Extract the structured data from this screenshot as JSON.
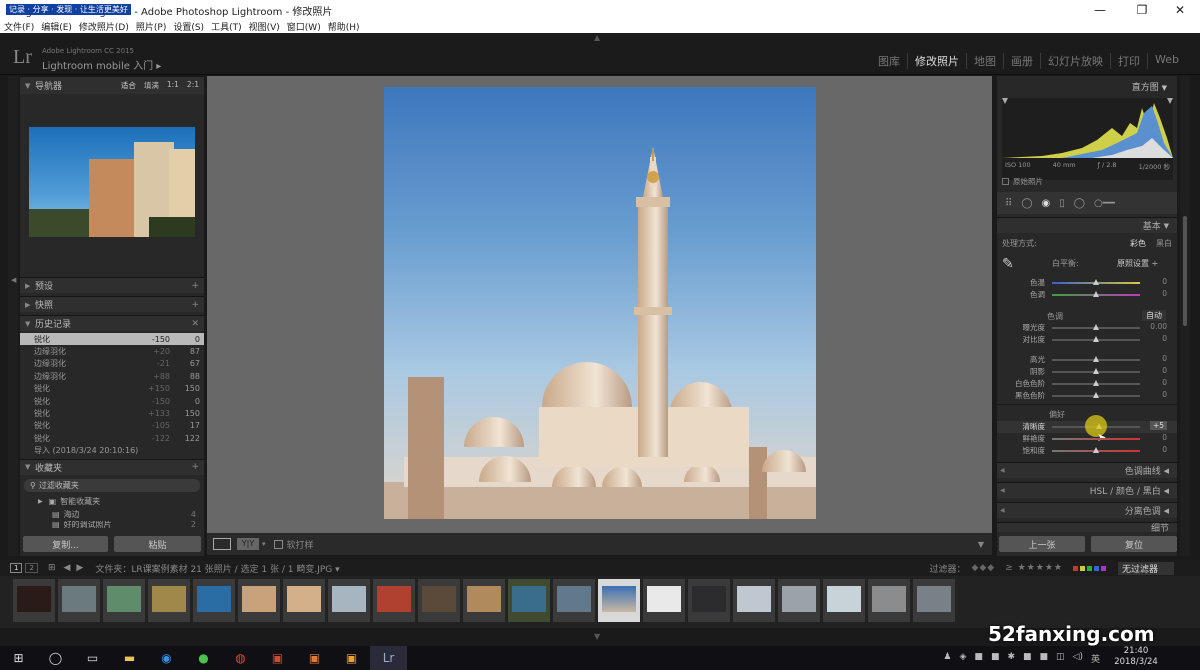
{
  "window": {
    "title": "lighroom Catalog.lrcat - Adobe Photoshop Lightroom - 修改照片",
    "overlay_text": "记录 · 分享 · 发现 · 让生活更美好"
  },
  "menu": [
    "文件(F)",
    "编辑(E)",
    "修改照片(D)",
    "照片(P)",
    "设置(S)",
    "工具(T)",
    "视图(V)",
    "窗口(W)",
    "帮助(H)"
  ],
  "identity": {
    "logo": "Lr",
    "product": "Adobe Lightroom CC 2015",
    "mobile": "Lightroom mobile 入门",
    "mobile_arrow": "▸"
  },
  "modules": [
    "图库",
    "修改照片",
    "地图",
    "画册",
    "幻灯片放映",
    "打印",
    "Web"
  ],
  "left": {
    "navigator": {
      "title": "导航器",
      "opts": [
        "适合",
        "填满",
        "1:1",
        "2:1"
      ]
    },
    "presets": "预设",
    "snapshots": "快照",
    "history": {
      "title": "历史记录",
      "rows": [
        {
          "name": "锐化",
          "v1": "-150",
          "v2": "0"
        },
        {
          "name": "边缘羽化",
          "v1": "+20",
          "v2": "87"
        },
        {
          "name": "边缘羽化",
          "v1": "-21",
          "v2": "67"
        },
        {
          "name": "边缘羽化",
          "v1": "+88",
          "v2": "88"
        },
        {
          "name": "锐化",
          "v1": "+150",
          "v2": "150"
        },
        {
          "name": "锐化",
          "v1": "-150",
          "v2": "0"
        },
        {
          "name": "锐化",
          "v1": "+133",
          "v2": "150"
        },
        {
          "name": "锐化",
          "v1": "-105",
          "v2": "17"
        },
        {
          "name": "锐化",
          "v1": "-122",
          "v2": "122"
        },
        {
          "name": "导入 (2018/3/24 20:10:16)",
          "v1": "",
          "v2": ""
        }
      ]
    },
    "collections": {
      "title": "收藏夹",
      "filter": "过滤收藏夹",
      "items": [
        {
          "name": "智能收藏夹",
          "count": ""
        },
        {
          "name": "海边",
          "count": "4"
        },
        {
          "name": "好的调试照片",
          "count": "2"
        }
      ]
    },
    "copy_btn": "复制...",
    "paste_btn": "粘贴"
  },
  "toolbar": {
    "softproof": "软打样"
  },
  "right": {
    "histogram_title": "直方图",
    "exif": [
      "ISO 100",
      "40 mm",
      "ƒ / 2.8",
      "1/2000 秒"
    ],
    "original": "原始照片",
    "basic_title": "基本",
    "treatment": {
      "label": "处理方式:",
      "color": "彩色",
      "bw": "黑白"
    },
    "wb": {
      "label": "白平衡:",
      "value": "原照设置 ÷"
    },
    "sliders_wb": [
      {
        "name": "色温",
        "value": "0"
      },
      {
        "name": "色调",
        "value": "0"
      }
    ],
    "tone": {
      "label": "色调",
      "auto": "自动"
    },
    "sliders_tone": [
      {
        "name": "曝光度",
        "value": "0.00"
      },
      {
        "name": "对比度",
        "value": "0"
      }
    ],
    "sliders_light": [
      {
        "name": "高光",
        "value": "0"
      },
      {
        "name": "阴影",
        "value": "0"
      },
      {
        "name": "白色色阶",
        "value": "0"
      },
      {
        "name": "黑色色阶",
        "value": "0"
      }
    ],
    "presence": {
      "label": "偏好"
    },
    "sliders_presence": [
      {
        "name": "清晰度",
        "value": "+5"
      },
      {
        "name": "鲜艳度",
        "value": "0"
      },
      {
        "name": "饱和度",
        "value": "0"
      }
    ],
    "panels": [
      "色调曲线",
      "HSL  /  颜色  /  黑白",
      "分离色调",
      "细节"
    ],
    "prev_btn": "上一张",
    "reset_btn": "复位"
  },
  "filmbar": {
    "pages": [
      "1",
      "2"
    ],
    "info": "文件夹：LR课案例素材  21 张照片 / 选定 1 张 / 1 畸变.JPG ▾",
    "filter_label": "过滤器：",
    "filter_value": "无过滤器"
  },
  "taskbar": {
    "time": "21:40",
    "date": "2018/3/24",
    "lang": "英"
  },
  "watermark": "52fanxing.com"
}
